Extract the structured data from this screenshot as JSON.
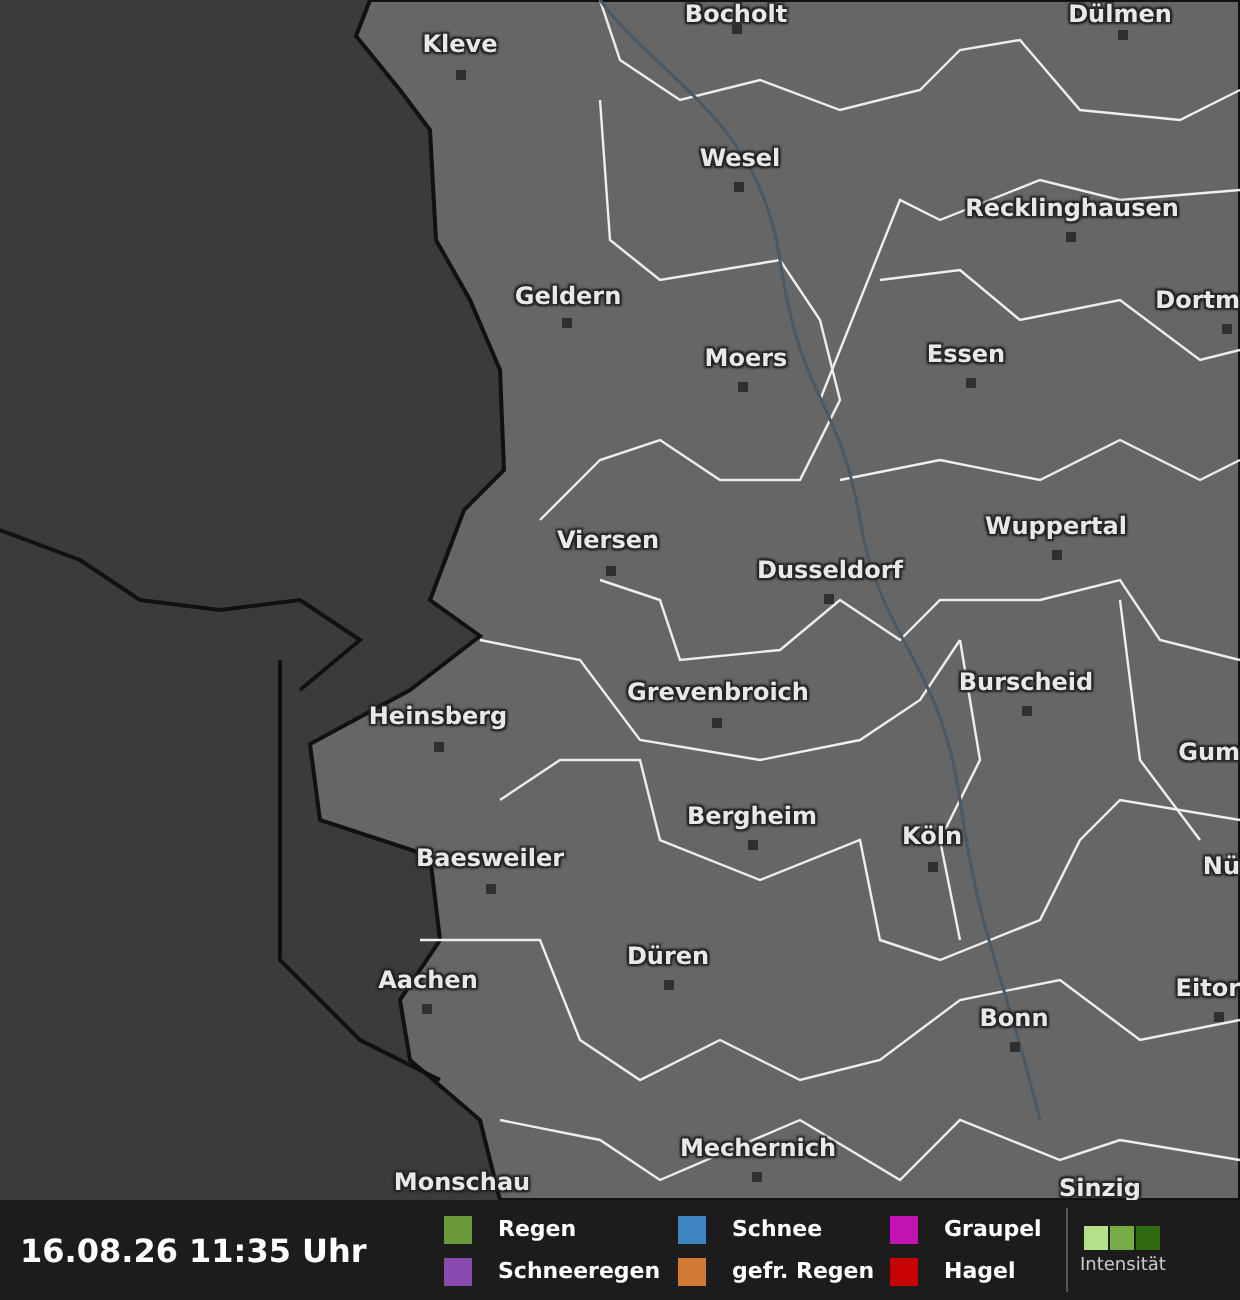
{
  "map": {
    "cities": [
      {
        "name": "Bocholt"
      },
      {
        "name": "Dülmen"
      },
      {
        "name": "Kleve"
      },
      {
        "name": "Wesel"
      },
      {
        "name": "Recklinghausen"
      },
      {
        "name": "Geldern"
      },
      {
        "name": "Dortm"
      },
      {
        "name": "Moers"
      },
      {
        "name": "Essen"
      },
      {
        "name": "Wuppertal"
      },
      {
        "name": "Viersen"
      },
      {
        "name": "Dusseldorf"
      },
      {
        "name": "Grevenbroich"
      },
      {
        "name": "Burscheid"
      },
      {
        "name": "Heinsberg"
      },
      {
        "name": "Gum"
      },
      {
        "name": "Bergheim"
      },
      {
        "name": "Köln"
      },
      {
        "name": "Baesweiler"
      },
      {
        "name": "Nü"
      },
      {
        "name": "Düren"
      },
      {
        "name": "Aachen"
      },
      {
        "name": "Eitor"
      },
      {
        "name": "Bonn"
      },
      {
        "name": "Mechernich"
      },
      {
        "name": "Monschau"
      },
      {
        "name": "Sinzig"
      }
    ]
  },
  "footer": {
    "timestamp": "16.08.26 11:35 Uhr",
    "legend": [
      {
        "label": "Regen",
        "color": "#6a9a3c"
      },
      {
        "label": "Schneeregen",
        "color": "#8a4bb0"
      },
      {
        "label": "Schnee",
        "color": "#3d85c0"
      },
      {
        "label": "gefr. Regen",
        "color": "#d07a36"
      },
      {
        "label": "Graupel",
        "color": "#c412b4"
      },
      {
        "label": "Hagel",
        "color": "#c80202"
      }
    ],
    "intensity_label": "Intensität"
  }
}
